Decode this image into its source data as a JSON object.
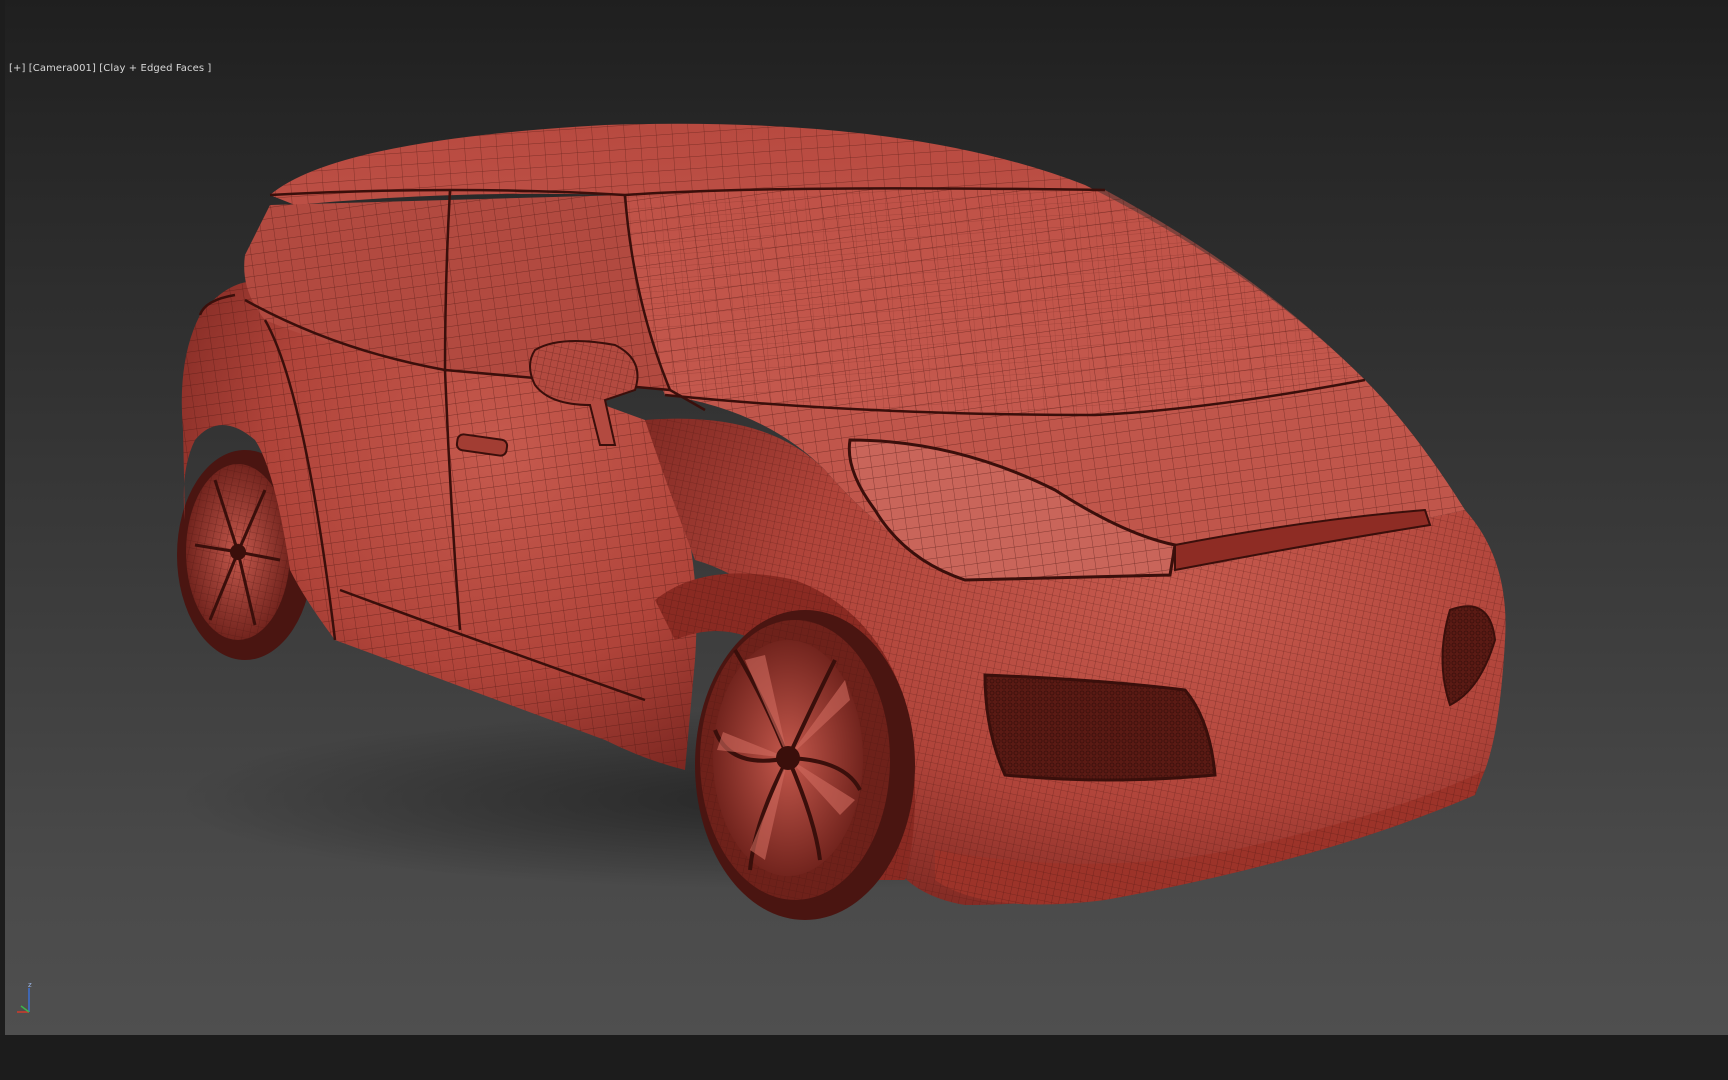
{
  "viewport": {
    "label_plus": "[+]",
    "label_camera": "[Camera001]",
    "label_shading": "[Clay + Edged Faces ]"
  },
  "axis_gizmo": {
    "z_label": "z",
    "x_color": "#d23a2a",
    "y_color": "#3bb54a",
    "z_color": "#3a6ed2"
  },
  "model": {
    "icon": "car-wireframe",
    "clay_color": "#b5453a",
    "edge_color": "#5a1a14"
  }
}
